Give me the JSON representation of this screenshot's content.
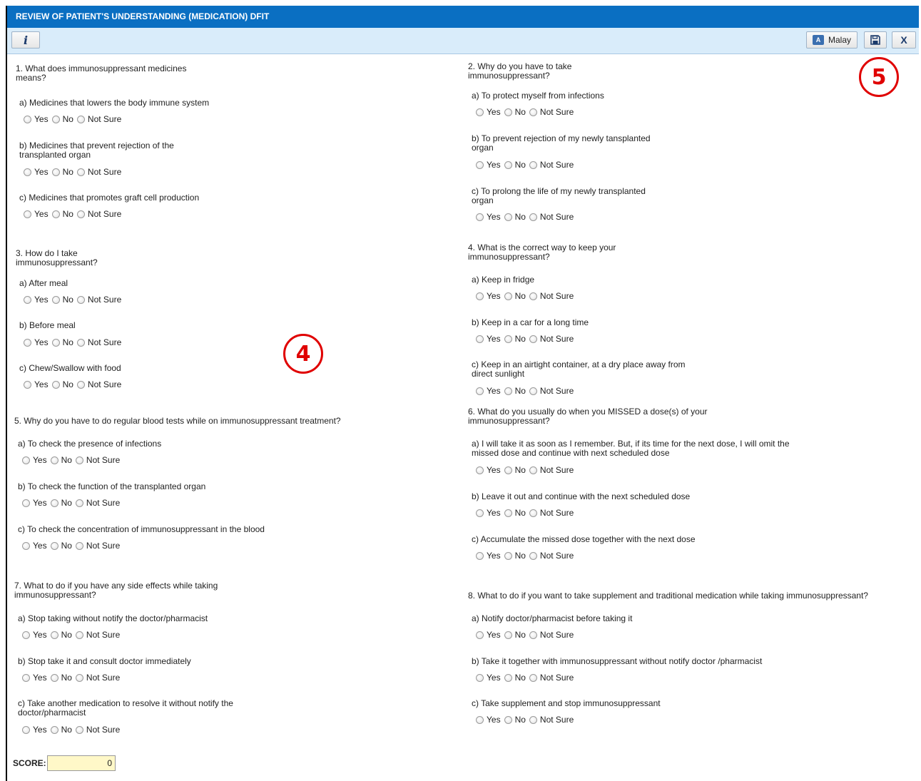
{
  "window": {
    "title": "REVIEW OF PATIENT'S UNDERSTANDING (MEDICATION) DFIT"
  },
  "toolbar": {
    "info_icon": "i",
    "language_label": "Malay",
    "close_label": "X"
  },
  "radio_labels": {
    "yes": "Yes",
    "no": "No",
    "not_sure": "Not Sure"
  },
  "questions": [
    {
      "title": "1. What does immunosuppressant medicines\nmeans?",
      "options": [
        "a) Medicines that lowers the body immune system",
        "b) Medicines that prevent rejection of the\ntransplanted organ",
        "c) Medicines that promotes graft cell production"
      ]
    },
    {
      "title": "2. Why do you have to take\nimmunosuppressant?",
      "options": [
        "a) To protect myself from infections",
        "b) To prevent rejection of my newly tansplanted\norgan",
        "c) To prolong the life of my newly transplanted\norgan"
      ]
    },
    {
      "title": "3. How do I take\nimmunosuppressant?",
      "options": [
        "a) After meal",
        "b) Before meal",
        "c) Chew/Swallow with food"
      ]
    },
    {
      "title": "4. What is the correct way to keep your\nimmunosuppressant?",
      "options": [
        "a) Keep in fridge",
        "b) Keep in a car for a long time",
        "c) Keep in an airtight container, at a dry place away from\ndirect sunlight"
      ]
    },
    {
      "title": "5. Why do you have to do regular blood tests while on immunosuppressant treatment?",
      "options": [
        "a) To check the presence of infections",
        "b) To check the function of the transplanted organ",
        "c) To check the concentration of immunosuppressant in the blood"
      ]
    },
    {
      "title": "6. What do you usually do when you MISSED a dose(s) of your\nimmunosuppressant?",
      "options": [
        "a) I will take it as soon as I remember. But, if its time for the next dose, I will omit the\nmissed dose and continue with next scheduled dose",
        "b) Leave it out and continue with the next scheduled dose",
        "c) Accumulate the missed dose together with the next dose"
      ]
    },
    {
      "title": "7. What to do if you have any side effects while taking\nimmunosuppressant?",
      "options": [
        "a) Stop taking without notify the doctor/pharmacist",
        "b) Stop take it and consult doctor immediately",
        "c) Take another medication to resolve it without notify the\ndoctor/pharmacist"
      ]
    },
    {
      "title": "8. What to do if you want to take supplement and traditional medication while taking immunosuppressant?",
      "options": [
        "a) Notify doctor/pharmacist before taking it",
        "b) Take it together with immunosuppressant without notify doctor /pharmacist",
        "c) Take supplement and stop immunosuppressant"
      ]
    }
  ],
  "score": {
    "label": "SCORE:",
    "value": "0"
  },
  "annotations": [
    "4",
    "5"
  ],
  "colors": {
    "title_bar": "#0a6fc2",
    "toolbar": "#d9ecfa",
    "score_field": "#fff8c8",
    "annotation": "#e00000"
  }
}
